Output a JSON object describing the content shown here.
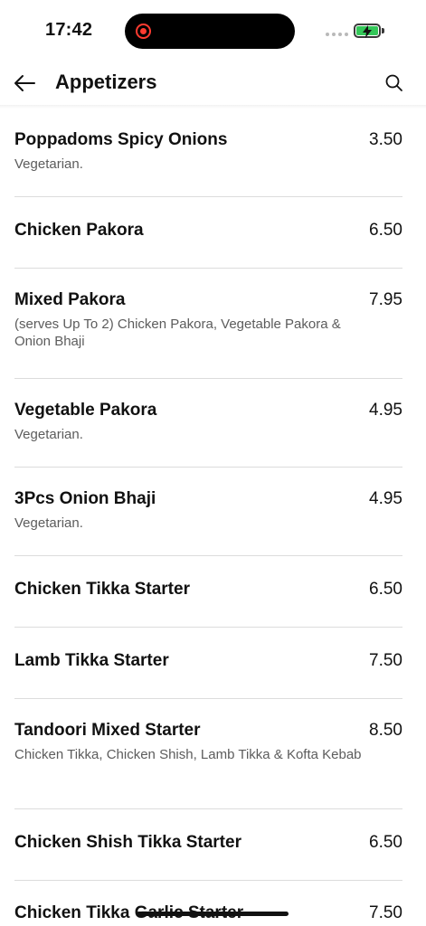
{
  "status_bar": {
    "time": "17:42",
    "battery_state": "charging",
    "battery_color": "#34c759",
    "recording_color": "#ff3b30"
  },
  "header": {
    "title": "Appetizers",
    "back_icon": "arrow-left-icon",
    "search_icon": "search-icon"
  },
  "items": [
    {
      "name": "Poppadoms Spicy Onions",
      "price": "3.50",
      "description": "Vegetarian."
    },
    {
      "name": "Chicken Pakora",
      "price": "6.50",
      "description": ""
    },
    {
      "name": "Mixed Pakora",
      "price": "7.95",
      "description": "(serves Up To 2) Chicken Pakora, Vegetable Pakora & Onion Bhaji"
    },
    {
      "name": "Vegetable Pakora",
      "price": "4.95",
      "description": "Vegetarian."
    },
    {
      "name": "3Pcs Onion Bhaji",
      "price": "4.95",
      "description": "Vegetarian."
    },
    {
      "name": "Chicken Tikka Starter",
      "price": "6.50",
      "description": ""
    },
    {
      "name": "Lamb Tikka Starter",
      "price": "7.50",
      "description": ""
    },
    {
      "name": "Tandoori Mixed Starter",
      "price": "8.50",
      "description": "Chicken Tikka, Chicken Shish, Lamb Tikka & Kofta Kebab"
    },
    {
      "name": "Chicken Shish Tikka Starter",
      "price": "6.50",
      "description": ""
    },
    {
      "name": "Chicken Tikka Garlic Starter",
      "price": "7.50",
      "description": ""
    }
  ]
}
